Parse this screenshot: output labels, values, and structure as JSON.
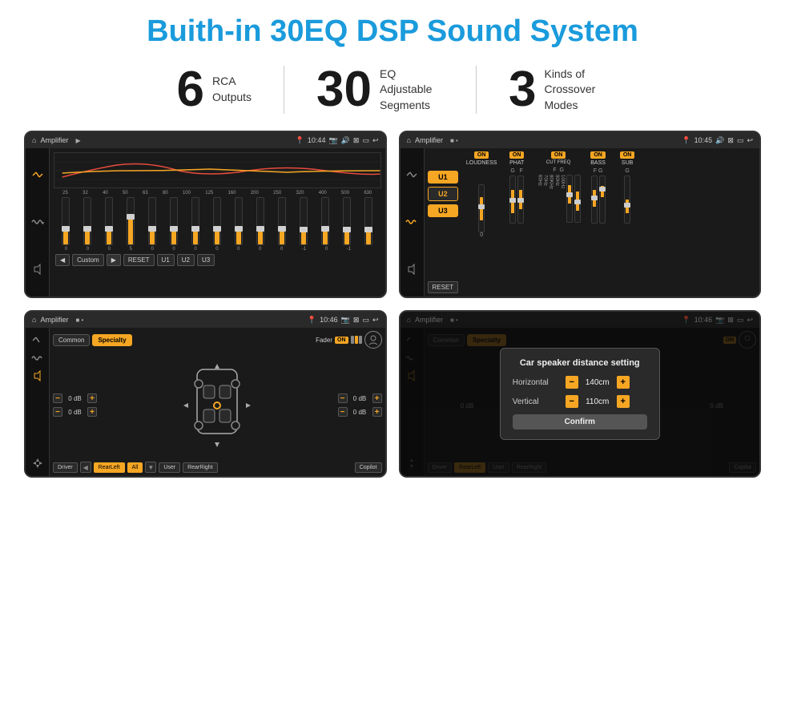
{
  "page": {
    "title": "Buith-in 30EQ DSP Sound System"
  },
  "stats": [
    {
      "number": "6",
      "text": "RCA\nOutputs"
    },
    {
      "number": "30",
      "text": "EQ Adjustable\nSegments"
    },
    {
      "number": "3",
      "text": "Kinds of\nCrossover Modes"
    }
  ],
  "screens": [
    {
      "id": "eq-screen",
      "statusbar": {
        "app": "Amplifier",
        "time": "10:44",
        "icons": "📍 🔊 ⊠ ▭ ↩"
      }
    },
    {
      "id": "crossover-screen",
      "statusbar": {
        "app": "Amplifier",
        "time": "10:45",
        "icons": "📍 🔊 ⊠ ▭ ↩"
      }
    },
    {
      "id": "fader-screen",
      "statusbar": {
        "app": "Amplifier",
        "time": "10:46",
        "icons": "📍 🔊 ⊠ ▭ ↩"
      }
    },
    {
      "id": "dialog-screen",
      "statusbar": {
        "app": "Amplifier",
        "time": "10:46",
        "icons": "📍 🔊 ⊠ ▭ ↩"
      },
      "dialog": {
        "title": "Car speaker distance setting",
        "horizontal_label": "Horizontal",
        "horizontal_value": "140cm",
        "vertical_label": "Vertical",
        "vertical_value": "110cm",
        "confirm_btn": "Confirm"
      }
    }
  ],
  "eq": {
    "frequencies": [
      "25",
      "32",
      "40",
      "50",
      "63",
      "80",
      "100",
      "125",
      "160",
      "200",
      "250",
      "320",
      "400",
      "500",
      "630"
    ],
    "values": [
      "0",
      "0",
      "0",
      "5",
      "0",
      "0",
      "0",
      "0",
      "0",
      "0",
      "0",
      "-1",
      "0",
      "-1",
      ""
    ],
    "preset": "Custom",
    "buttons": [
      "U1",
      "U2",
      "U3"
    ],
    "reset_btn": "RESET"
  },
  "crossover": {
    "u_buttons": [
      "U1",
      "U2",
      "U3"
    ],
    "sections": [
      {
        "on": true,
        "label": "LOUDNESS"
      },
      {
        "on": true,
        "label": "PHAT"
      },
      {
        "on": true,
        "label": "CUT FREQ"
      },
      {
        "on": true,
        "label": "BASS"
      },
      {
        "on": true,
        "label": "SUB"
      }
    ],
    "reset_btn": "RESET"
  },
  "fader": {
    "tabs": [
      "Common",
      "Specialty"
    ],
    "active_tab": "Specialty",
    "fader_label": "Fader",
    "on_label": "ON",
    "db_values": [
      "0 dB",
      "0 dB",
      "0 dB",
      "0 dB"
    ],
    "bottom_buttons": [
      "Driver",
      "RearLeft",
      "All",
      "User",
      "RearRight",
      "Copilot"
    ]
  },
  "dialog": {
    "title": "Car speaker distance setting",
    "horizontal_label": "Horizontal",
    "horizontal_value": "140cm",
    "vertical_label": "Vertical",
    "vertical_value": "110cm",
    "confirm": "Confirm"
  }
}
